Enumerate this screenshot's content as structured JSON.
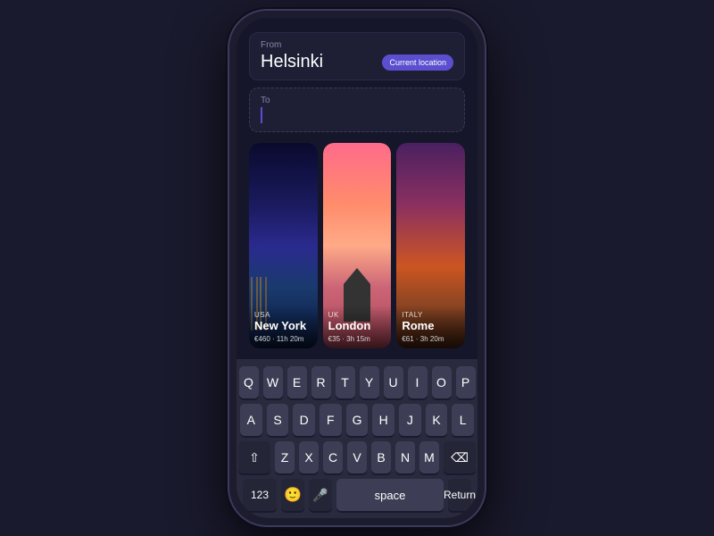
{
  "phone": {
    "app": {
      "from_label": "From",
      "from_value": "Helsinki",
      "current_location_label": "Current location",
      "to_label": "To"
    },
    "destinations": [
      {
        "country": "USA",
        "city": "New York",
        "price": "€460 · 11h 20m",
        "card_class": "card-ny"
      },
      {
        "country": "UK",
        "city": "London",
        "price": "€35 · 3h 15m",
        "card_class": "card-london"
      },
      {
        "country": "ITALY",
        "city": "Rome",
        "price": "€61 · 3h 20m",
        "card_class": "card-rome"
      }
    ],
    "keyboard": {
      "row1": [
        "Q",
        "W",
        "E",
        "R",
        "T",
        "Y",
        "U",
        "I",
        "O",
        "P"
      ],
      "row2": [
        "A",
        "S",
        "D",
        "F",
        "G",
        "H",
        "J",
        "K",
        "L"
      ],
      "row3": [
        "Z",
        "X",
        "C",
        "V",
        "B",
        "N",
        "M"
      ],
      "num_label": "123",
      "space_label": "space",
      "return_label": "Return"
    }
  }
}
